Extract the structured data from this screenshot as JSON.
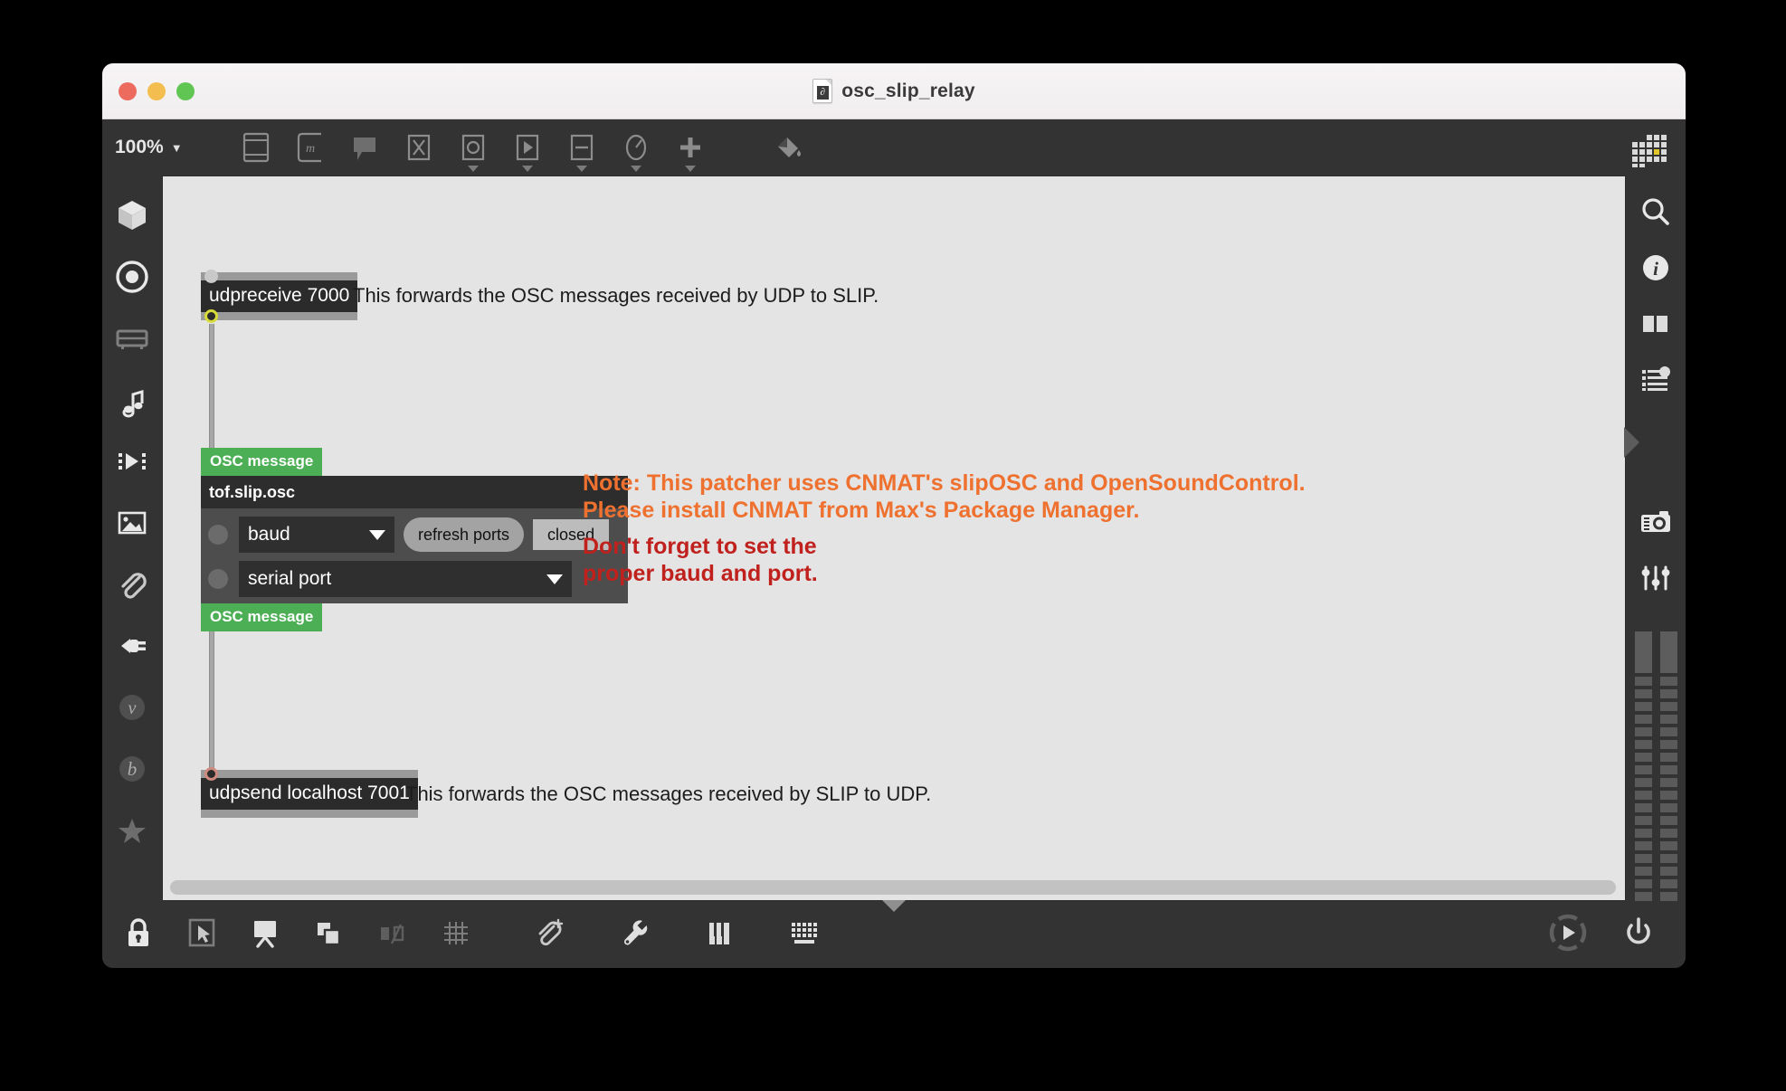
{
  "window": {
    "title": "osc_slip_relay",
    "doc_icon_glyph": "∂",
    "traffic_lights": [
      "close",
      "minimize",
      "zoom"
    ]
  },
  "toolbar": {
    "zoom_level": "100%",
    "zoom_caret": "▼",
    "items": [
      {
        "name": "object-box-icon",
        "label": "Object"
      },
      {
        "name": "message-box-icon",
        "label": "Message"
      },
      {
        "name": "comment-icon",
        "label": "Comment"
      },
      {
        "name": "toggle-icon",
        "label": "Toggle"
      },
      {
        "name": "button-icon",
        "label": "Button"
      },
      {
        "name": "playbar-icon",
        "label": "Playbar"
      },
      {
        "name": "slider-icon",
        "label": "Slider"
      },
      {
        "name": "dial-icon",
        "label": "Dial"
      },
      {
        "name": "plus-icon",
        "label": "Add"
      },
      {
        "name": "paint-bucket-icon",
        "label": "Color"
      }
    ],
    "grid_indicator": "grid-indicator"
  },
  "left_rail": {
    "items": [
      {
        "name": "sidebar-item-packages",
        "icon": "cube-icon",
        "label": "Packages"
      },
      {
        "name": "sidebar-item-objects",
        "icon": "target-icon",
        "label": "Objects"
      },
      {
        "name": "sidebar-item-clippings",
        "icon": "drawer-icon",
        "label": "Clippings"
      },
      {
        "name": "sidebar-item-audio",
        "icon": "music-note-icon",
        "label": "Audio"
      },
      {
        "name": "sidebar-item-video",
        "icon": "film-icon",
        "label": "Video"
      },
      {
        "name": "sidebar-item-images",
        "icon": "image-icon",
        "label": "Images"
      },
      {
        "name": "sidebar-item-attachments",
        "icon": "paperclip-icon",
        "label": "Attachments"
      },
      {
        "name": "sidebar-item-devices",
        "icon": "plug-icon",
        "label": "Devices"
      },
      {
        "name": "sidebar-item-vizzie",
        "icon": "letter-v-icon",
        "label": "v"
      },
      {
        "name": "sidebar-item-beap",
        "icon": "letter-b-icon",
        "label": "b"
      },
      {
        "name": "sidebar-item-favorites",
        "icon": "star-icon",
        "label": "Favorites"
      }
    ]
  },
  "right_rail": {
    "items": [
      {
        "name": "search-button",
        "icon": "search-icon",
        "label": "Search"
      },
      {
        "name": "inspector-button",
        "icon": "info-icon",
        "label": "Inspector"
      },
      {
        "name": "panels-button",
        "icon": "columns-icon",
        "label": "Panels"
      },
      {
        "name": "parameters-button",
        "icon": "list-dot-icon",
        "label": "Parameters"
      },
      {
        "name": "snapshot-button",
        "icon": "camera-icon",
        "label": "Snapshot"
      },
      {
        "name": "mixer-button",
        "icon": "sliders-icon",
        "label": "Mixer"
      }
    ],
    "meter_segments": 22
  },
  "bottom_bar": {
    "items": [
      {
        "name": "lock-button",
        "icon": "lock-icon",
        "label": "Lock"
      },
      {
        "name": "edit-mode-button",
        "icon": "cursor-icon",
        "label": "Edit"
      },
      {
        "name": "presentation-button",
        "icon": "presentation-icon",
        "label": "Presentation"
      },
      {
        "name": "layers-button",
        "icon": "layers-icon",
        "label": "Layers"
      },
      {
        "name": "align-button",
        "icon": "align-icon",
        "label": "Align"
      },
      {
        "name": "grid-button",
        "icon": "grid-icon",
        "label": "Grid"
      },
      {
        "name": "add-attachment-button",
        "icon": "paperclip-plus-icon",
        "label": "Attach"
      },
      {
        "name": "debug-button",
        "icon": "wrench-icon",
        "label": "Debug"
      },
      {
        "name": "piano-button",
        "icon": "piano-icon",
        "label": "Keyboard"
      },
      {
        "name": "keyboard-button",
        "icon": "keys-icon",
        "label": "Keys"
      }
    ],
    "right_items": [
      {
        "name": "audio-on-button",
        "icon": "play-circle-icon",
        "label": "Audio On"
      },
      {
        "name": "power-button",
        "icon": "power-icon",
        "label": "Power"
      }
    ]
  },
  "patcher": {
    "objects": [
      {
        "name": "udpreceive-object",
        "text": "udpreceive 7000"
      },
      {
        "name": "udpsend-object",
        "text": "udpsend localhost 7001"
      }
    ],
    "comments": [
      {
        "name": "comment-udpreceive",
        "text": "This forwards the OSC messages received by UDP to SLIP."
      },
      {
        "name": "comment-udpsend",
        "text": "This forwards the OSC messages received by SLIP to UDP."
      }
    ],
    "osc_labels": [
      {
        "name": "osc-message-label-top",
        "text": "OSC message"
      },
      {
        "name": "osc-message-label-bottom",
        "text": "OSC message"
      }
    ],
    "slip_panel": {
      "title": "tof.slip.osc",
      "baud_menu": {
        "value": "baud",
        "arrow": "▼"
      },
      "refresh_button": "refresh ports",
      "status_button": "closed",
      "port_menu": {
        "value": "serial port",
        "arrow": "▼"
      }
    },
    "notes": {
      "orange_line1": "Note: This patcher uses CNMAT's slipOSC and OpenSoundControl.",
      "orange_line2": "Please install CNMAT from Max's Package Manager.",
      "red_line1": "Don't forget to set the",
      "red_line2": "proper baud and port."
    }
  },
  "colors": {
    "note_orange": "#ef7130",
    "note_red": "#c0211d",
    "osc_green": "#4caf56",
    "chrome_dark": "#333333",
    "canvas_bg": "#e4e4e4",
    "object_bg": "#2b2b2b",
    "outlet_yellow": "#d8db3a"
  }
}
